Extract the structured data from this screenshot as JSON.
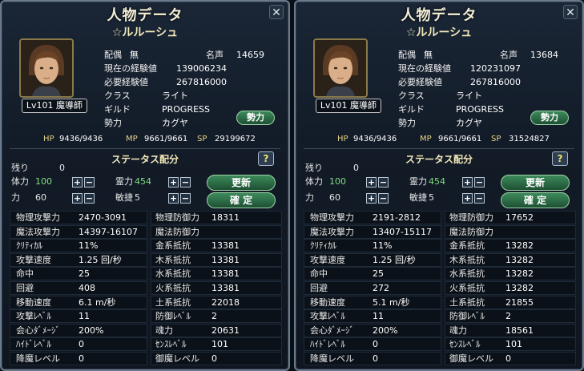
{
  "panels": [
    {
      "title": "人物データ",
      "name": "☆ルルーシュ",
      "level": "Lv101 魔導師",
      "info": {
        "haigu_label": "配偶",
        "haigu_value": "無",
        "meisei_label": "名声",
        "meisei_value": "14659",
        "exp_label": "現在の経験値",
        "exp_value": "139006234",
        "need_label": "必要経験値",
        "need_value": "267816000",
        "class_label": "クラス",
        "class_value": "ライト",
        "guild_label": "ギルド",
        "guild_value": "PROGRESS",
        "faction_label": "勢力",
        "faction_value": "カグヤ"
      },
      "faction_button": "勢力",
      "hp_label": "HP",
      "hp_value": "9436/9436",
      "mp_label": "MP",
      "mp_value": "9661/9661",
      "sp_label": "SP",
      "sp_value": "29199672",
      "status_title": "ステータス配分",
      "help": "?",
      "remain_label": "残り",
      "remain_value": "0",
      "tairyoku_label": "体力",
      "tairyoku_value": "100",
      "chikara_label": "力",
      "chikara_value": "60",
      "reiryoku_label": "霊力",
      "reiryoku_value": "454",
      "binsho_label": "敏捷",
      "binsho_value": "5",
      "update_button": "更新",
      "confirm_button": "確 定",
      "stats": [
        {
          "l1": "物理攻撃力",
          "v1": "2470-3091",
          "l2": "物理防御力",
          "v2": "18311"
        },
        {
          "l1": "魔法攻撃力",
          "v1": "14397-16107",
          "l2": "魔法防御力",
          "v2": ""
        },
        {
          "l1": "ｸﾘﾃｨｶﾙ",
          "v1": "11%",
          "l2": "金系抵抗",
          "v2": "13381"
        },
        {
          "l1": "攻撃速度",
          "v1": "1.25 回/秒",
          "l2": "木系抵抗",
          "v2": "13381"
        },
        {
          "l1": "命中",
          "v1": "25",
          "l2": "水系抵抗",
          "v2": "13381"
        },
        {
          "l1": "回避",
          "v1": "408",
          "l2": "火系抵抗",
          "v2": "13381"
        },
        {
          "l1": "移動速度",
          "v1": "6.1 m/秒",
          "l2": "土系抵抗",
          "v2": "22018"
        },
        {
          "l1": "攻撃ﾚﾍﾞﾙ",
          "v1": "11",
          "l2": "防御ﾚﾍﾞﾙ",
          "v2": "2"
        },
        {
          "l1": "会心ﾀﾞﾒｰｼﾞ",
          "v1": "200%",
          "l2": "魂力",
          "v2": "20631"
        },
        {
          "l1": "ﾊｲﾄﾞﾚﾍﾞﾙ",
          "v1": "0",
          "l2": "ｾﾝｽﾚﾍﾞﾙ",
          "v2": "101"
        },
        {
          "l1": "降魔レベル",
          "v1": "0",
          "l2": "御魔レベル",
          "v2": "0"
        }
      ]
    },
    {
      "title": "人物データ",
      "name": "☆ルルーシュ",
      "level": "Lv101 魔導師",
      "info": {
        "haigu_label": "配偶",
        "haigu_value": "無",
        "meisei_label": "名声",
        "meisei_value": "13684",
        "exp_label": "現在の経験値",
        "exp_value": "120231097",
        "need_label": "必要経験値",
        "need_value": "267816000",
        "class_label": "クラス",
        "class_value": "ライト",
        "guild_label": "ギルド",
        "guild_value": "PROGRESS",
        "faction_label": "勢力",
        "faction_value": "カグヤ"
      },
      "faction_button": "勢力",
      "hp_label": "HP",
      "hp_value": "9436/9436",
      "mp_label": "MP",
      "mp_value": "9661/9661",
      "sp_label": "SP",
      "sp_value": "31524827",
      "status_title": "ステータス配分",
      "help": "?",
      "remain_label": "残り",
      "remain_value": "0",
      "tairyoku_label": "体力",
      "tairyoku_value": "100",
      "chikara_label": "力",
      "chikara_value": "60",
      "reiryoku_label": "霊力",
      "reiryoku_value": "454",
      "binsho_label": "敏捷",
      "binsho_value": "5",
      "update_button": "更新",
      "confirm_button": "確 定",
      "stats": [
        {
          "l1": "物理攻撃力",
          "v1": "2191-2812",
          "l2": "物理防御力",
          "v2": "17652"
        },
        {
          "l1": "魔法攻撃力",
          "v1": "13407-15117",
          "l2": "魔法防御力",
          "v2": ""
        },
        {
          "l1": "ｸﾘﾃｨｶﾙ",
          "v1": "11%",
          "l2": "金系抵抗",
          "v2": "13282"
        },
        {
          "l1": "攻撃速度",
          "v1": "1.25 回/秒",
          "l2": "木系抵抗",
          "v2": "13282"
        },
        {
          "l1": "命中",
          "v1": "25",
          "l2": "水系抵抗",
          "v2": "13282"
        },
        {
          "l1": "回避",
          "v1": "272",
          "l2": "火系抵抗",
          "v2": "13282"
        },
        {
          "l1": "移動速度",
          "v1": "5.1 m/秒",
          "l2": "土系抵抗",
          "v2": "21855"
        },
        {
          "l1": "攻撃ﾚﾍﾞﾙ",
          "v1": "11",
          "l2": "防御ﾚﾍﾞﾙ",
          "v2": "2"
        },
        {
          "l1": "会心ﾀﾞﾒｰｼﾞ",
          "v1": "200%",
          "l2": "魂力",
          "v2": "18561"
        },
        {
          "l1": "ﾊｲﾄﾞﾚﾍﾞﾙ",
          "v1": "0",
          "l2": "ｾﾝｽﾚﾍﾞﾙ",
          "v2": "101"
        },
        {
          "l1": "降魔レベル",
          "v1": "0",
          "l2": "御魔レベル",
          "v2": "0"
        }
      ]
    }
  ]
}
